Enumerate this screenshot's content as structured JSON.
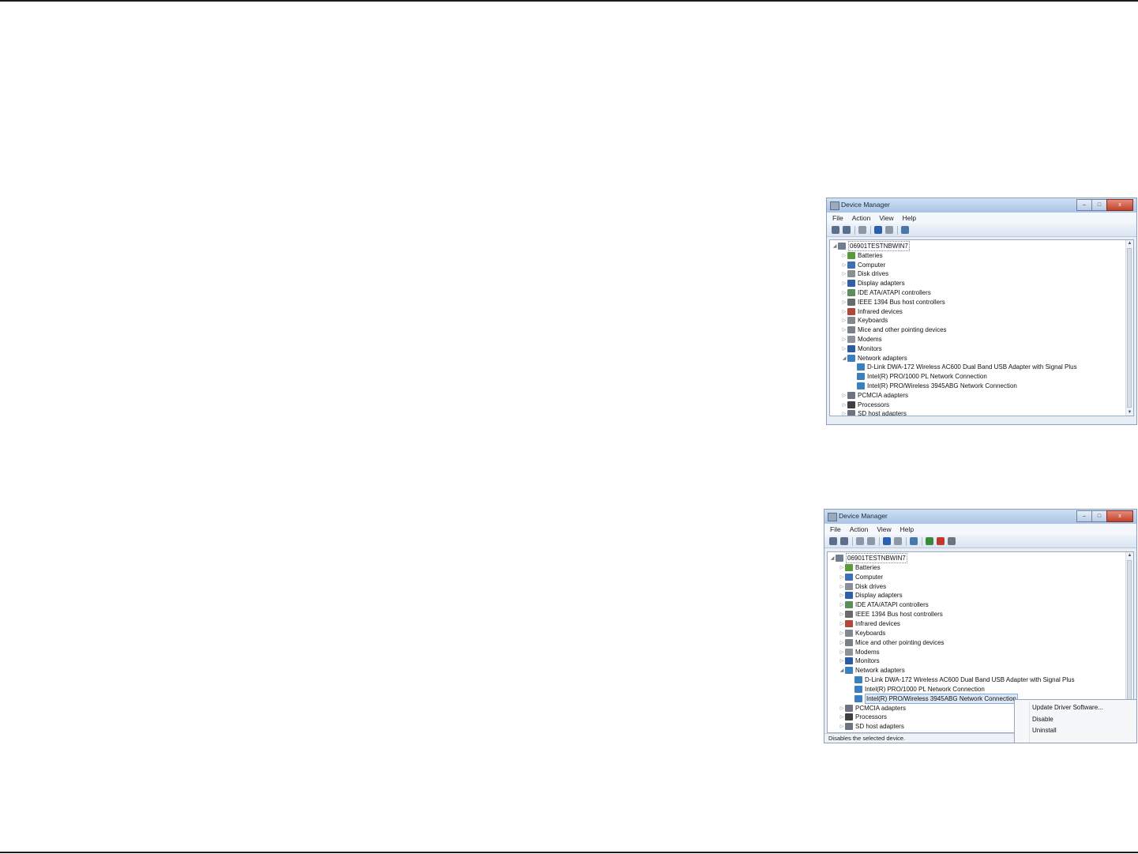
{
  "windows": [
    {
      "title": "Device Manager",
      "window_buttons": [
        "–",
        "□",
        "x"
      ],
      "menu": [
        "File",
        "Action",
        "View",
        "Help"
      ],
      "tree": [
        {
          "label": "06901TESTNBWIN7",
          "level": 0,
          "arrow": "◢",
          "icon": "computer-icon",
          "color": "#6f7f90"
        },
        {
          "label": "Batteries",
          "level": 1,
          "arrow": "▷",
          "icon": "battery-icon",
          "color": "#5a9a3a"
        },
        {
          "label": "Computer",
          "level": 1,
          "arrow": "▷",
          "icon": "computer-icon",
          "color": "#3e6fb3"
        },
        {
          "label": "Disk drives",
          "level": 1,
          "arrow": "▷",
          "icon": "disk-drive-icon",
          "color": "#8a8f96"
        },
        {
          "label": "Display adapters",
          "level": 1,
          "arrow": "▷",
          "icon": "display-adapter-icon",
          "color": "#2f5fa8"
        },
        {
          "label": "IDE ATA/ATAPI controllers",
          "level": 1,
          "arrow": "▷",
          "icon": "ide-controller-icon",
          "color": "#5c8d5a"
        },
        {
          "label": "IEEE 1394 Bus host controllers",
          "level": 1,
          "arrow": "▷",
          "icon": "ieee1394-icon",
          "color": "#6a6a6a"
        },
        {
          "label": "Infrared devices",
          "level": 1,
          "arrow": "▷",
          "icon": "infrared-icon",
          "color": "#b0473a"
        },
        {
          "label": "Keyboards",
          "level": 1,
          "arrow": "▷",
          "icon": "keyboard-icon",
          "color": "#808890"
        },
        {
          "label": "Mice and other pointing devices",
          "level": 1,
          "arrow": "▷",
          "icon": "mouse-icon",
          "color": "#7b7f86"
        },
        {
          "label": "Modems",
          "level": 1,
          "arrow": "▷",
          "icon": "modem-icon",
          "color": "#8b929b"
        },
        {
          "label": "Monitors",
          "level": 1,
          "arrow": "▷",
          "icon": "monitor-icon",
          "color": "#2e5aa3"
        },
        {
          "label": "Network adapters",
          "level": 1,
          "arrow": "◢",
          "icon": "network-adapter-icon",
          "color": "#3a7fbf"
        },
        {
          "label": "D-Link DWA-172 Wireless AC600 Dual Band USB Adapter with Signal Plus",
          "level": 2,
          "arrow": "",
          "icon": "network-adapter-icon",
          "color": "#3a7fbf"
        },
        {
          "label": "Intel(R) PRO/1000 PL Network Connection",
          "level": 2,
          "arrow": "",
          "icon": "network-adapter-icon",
          "color": "#3a7fbf"
        },
        {
          "label": "Intel(R) PRO/Wireless 3945ABG Network Connection",
          "level": 2,
          "arrow": "",
          "icon": "network-adapter-icon",
          "color": "#3a7fbf"
        },
        {
          "label": "PCMCIA adapters",
          "level": 1,
          "arrow": "▷",
          "icon": "pcmcia-icon",
          "color": "#6d7480"
        },
        {
          "label": "Processors",
          "level": 1,
          "arrow": "▷",
          "icon": "processor-icon",
          "color": "#3f3f3f"
        },
        {
          "label": "SD host adapters",
          "level": 1,
          "arrow": "▷",
          "icon": "sd-host-icon",
          "color": "#6d7480"
        }
      ]
    },
    {
      "title": "Device Manager",
      "window_buttons": [
        "–",
        "□",
        "x"
      ],
      "menu": [
        "File",
        "Action",
        "View",
        "Help"
      ],
      "selected_item": "Intel(R) PRO/Wireless 3945ABG Network Connection",
      "status": "Disables the selected device.",
      "context_menu": [
        "Update Driver Software...",
        "Disable",
        "Uninstall"
      ],
      "tree": [
        {
          "label": "06901TESTNBWIN7",
          "level": 0,
          "arrow": "◢",
          "icon": "computer-icon",
          "color": "#6f7f90"
        },
        {
          "label": "Batteries",
          "level": 1,
          "arrow": "▷",
          "icon": "battery-icon",
          "color": "#5a9a3a"
        },
        {
          "label": "Computer",
          "level": 1,
          "arrow": "▷",
          "icon": "computer-icon",
          "color": "#3e6fb3"
        },
        {
          "label": "Disk drives",
          "level": 1,
          "arrow": "▷",
          "icon": "disk-drive-icon",
          "color": "#8a8f96"
        },
        {
          "label": "Display adapters",
          "level": 1,
          "arrow": "▷",
          "icon": "display-adapter-icon",
          "color": "#2f5fa8"
        },
        {
          "label": "IDE ATA/ATAPI controllers",
          "level": 1,
          "arrow": "▷",
          "icon": "ide-controller-icon",
          "color": "#5c8d5a"
        },
        {
          "label": "IEEE 1394 Bus host controllers",
          "level": 1,
          "arrow": "▷",
          "icon": "ieee1394-icon",
          "color": "#6a6a6a"
        },
        {
          "label": "Infrared devices",
          "level": 1,
          "arrow": "▷",
          "icon": "infrared-icon",
          "color": "#b0473a"
        },
        {
          "label": "Keyboards",
          "level": 1,
          "arrow": "▷",
          "icon": "keyboard-icon",
          "color": "#808890"
        },
        {
          "label": "Mice and other pointing devices",
          "level": 1,
          "arrow": "▷",
          "icon": "mouse-icon",
          "color": "#7b7f86"
        },
        {
          "label": "Modems",
          "level": 1,
          "arrow": "▷",
          "icon": "modem-icon",
          "color": "#8b929b"
        },
        {
          "label": "Monitors",
          "level": 1,
          "arrow": "▷",
          "icon": "monitor-icon",
          "color": "#2e5aa3"
        },
        {
          "label": "Network adapters",
          "level": 1,
          "arrow": "◢",
          "icon": "network-adapter-icon",
          "color": "#3a7fbf"
        },
        {
          "label": "D-Link DWA-172 Wireless AC600 Dual Band USB Adapter with Signal Plus",
          "level": 2,
          "arrow": "",
          "icon": "network-adapter-icon",
          "color": "#3a7fbf"
        },
        {
          "label": "Intel(R) PRO/1000 PL Network Connection",
          "level": 2,
          "arrow": "",
          "icon": "network-adapter-icon",
          "color": "#3a7fbf"
        },
        {
          "label": "Intel(R) PRO/Wireless 3945ABG Network Connection",
          "level": 2,
          "arrow": "",
          "icon": "network-adapter-icon",
          "color": "#3a7fbf"
        },
        {
          "label": "PCMCIA adapters",
          "level": 1,
          "arrow": "▷",
          "icon": "pcmcia-icon",
          "color": "#6d7480"
        },
        {
          "label": "Processors",
          "level": 1,
          "arrow": "▷",
          "icon": "processor-icon",
          "color": "#3f3f3f"
        },
        {
          "label": "SD host adapters",
          "level": 1,
          "arrow": "▷",
          "icon": "sd-host-icon",
          "color": "#6d7480"
        }
      ]
    }
  ],
  "toolbar_icons_1": [
    {
      "name": "back-icon",
      "color": "#5a6f8c"
    },
    {
      "name": "forward-icon",
      "color": "#5a6f8c"
    },
    {
      "name": "sep"
    },
    {
      "name": "show-hide-console-tree-icon",
      "color": "#8b98a8"
    },
    {
      "name": "sep"
    },
    {
      "name": "help-icon",
      "color": "#2d5fb0"
    },
    {
      "name": "properties-icon",
      "color": "#8b98a8"
    },
    {
      "name": "sep"
    },
    {
      "name": "scan-hardware-icon",
      "color": "#4a78a8"
    }
  ],
  "toolbar_icons_2": [
    {
      "name": "back-icon",
      "color": "#5a6f8c"
    },
    {
      "name": "forward-icon",
      "color": "#5a6f8c"
    },
    {
      "name": "sep"
    },
    {
      "name": "show-hide-console-tree-icon",
      "color": "#8b98a8"
    },
    {
      "name": "properties-page-icon",
      "color": "#8b98a8"
    },
    {
      "name": "sep"
    },
    {
      "name": "help-icon",
      "color": "#2d5fb0"
    },
    {
      "name": "properties-icon",
      "color": "#8b98a8"
    },
    {
      "name": "sep"
    },
    {
      "name": "scan-hardware-icon",
      "color": "#4a78a8"
    },
    {
      "name": "sep"
    },
    {
      "name": "update-driver-icon",
      "color": "#3b8a3b"
    },
    {
      "name": "uninstall-icon",
      "color": "#c0392b"
    },
    {
      "name": "disable-icon",
      "color": "#6d7480"
    }
  ]
}
